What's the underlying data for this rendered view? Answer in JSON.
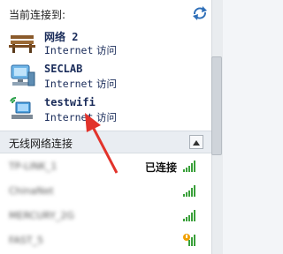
{
  "header": {
    "title": "当前连接到:"
  },
  "connections": [
    {
      "name": "网络  2",
      "access_en": "Internet",
      "access_zh": "访问",
      "icon": "park-bench-icon"
    },
    {
      "name": "SECLAB",
      "access_en": "Internet",
      "access_zh": "访问",
      "icon": "computer-icon"
    },
    {
      "name": "testwifi",
      "access_en": "Internet",
      "access_zh": "访问",
      "icon": "wireless-network-icon"
    }
  ],
  "wireless": {
    "title": "无线网络连接",
    "networks": [
      {
        "ssid": "TP-LINK_1",
        "status": "已连接",
        "signal": 5
      },
      {
        "ssid": "ChinaNet",
        "status": "",
        "signal": 5
      },
      {
        "ssid": "MERCURY_2G",
        "status": "",
        "signal": 5
      },
      {
        "ssid": "FAST_5",
        "status": "",
        "signal": 4
      }
    ]
  },
  "colors": {
    "arrow": "#e2332b",
    "signal": "#3aa03a"
  }
}
